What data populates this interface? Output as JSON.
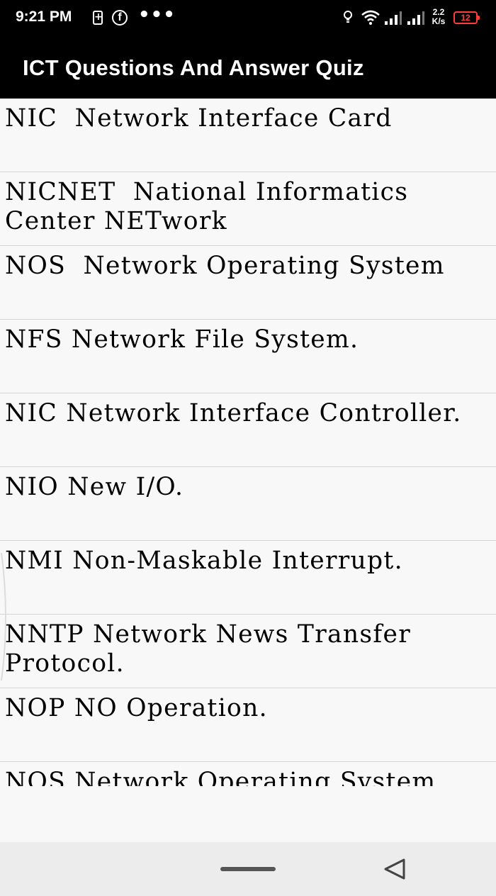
{
  "status_bar": {
    "time": "9:21 PM",
    "speed_top": "2.2",
    "speed_bottom": "K/s",
    "battery_level": "12"
  },
  "app_bar": {
    "title": "ICT Questions And Answer Quiz"
  },
  "items": [
    {
      "text": "NIC  Network Interface Card"
    },
    {
      "text": "NICNET  National Informatics Center NETwork"
    },
    {
      "text": "NOS  Network Operating System"
    },
    {
      "text": "NFS Network File System."
    },
    {
      "text": "NIC Network Interface Controller."
    },
    {
      "text": "NIO New I/O."
    },
    {
      "text": "NMI Non-Maskable Interrupt."
    },
    {
      "text": "NNTP Network News Transfer Protocol."
    },
    {
      "text": "NOP NO Operation."
    },
    {
      "text": "NOS Network Operating System"
    }
  ],
  "icons": {
    "status_left": [
      "battery-saver-icon",
      "facebook-icon",
      "more-dots-icon"
    ],
    "status_right": [
      "bulb-icon",
      "wifi-icon",
      "signal-icon",
      "signal-icon",
      "battery-icon"
    ],
    "nav": [
      "home-pill-icon",
      "back-icon"
    ]
  },
  "colors": {
    "app_bar": "#000000",
    "list_background": "#f8f8f8",
    "divider": "#d4d4d4",
    "battery_low": "#ff3b3b",
    "nav_bar": "#ececec"
  }
}
